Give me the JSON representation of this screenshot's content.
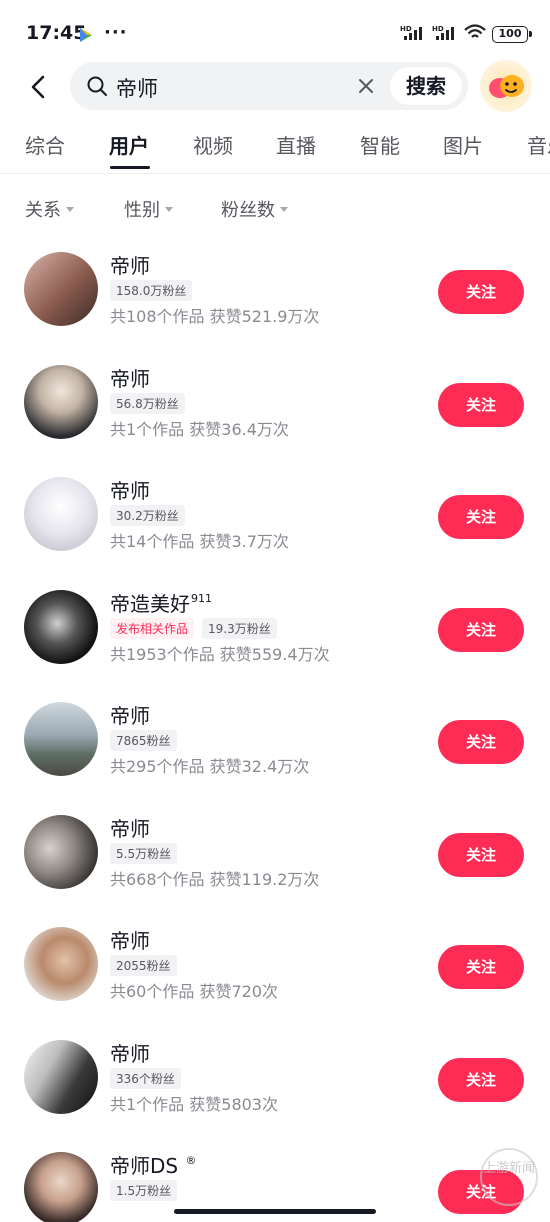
{
  "status_bar": {
    "time": "17:45",
    "dots": "···",
    "battery": "100"
  },
  "search": {
    "query": "帝师",
    "button": "搜索"
  },
  "tabs": [
    "综合",
    "用户",
    "视频",
    "直播",
    "智能",
    "图片",
    "音乐"
  ],
  "active_tab": "用户",
  "filters": [
    "关系",
    "性别",
    "粉丝数"
  ],
  "users": [
    {
      "name": "帝师",
      "badges": [
        {
          "text": "158.0万粉丝",
          "style": "gray"
        }
      ],
      "stats": "共108个作品 获赞521.9万次",
      "follow": "关注"
    },
    {
      "name": "帝师",
      "badges": [
        {
          "text": "56.8万粉丝",
          "style": "gray"
        }
      ],
      "stats": "共1个作品 获赞36.4万次",
      "follow": "关注"
    },
    {
      "name": "帝师",
      "badges": [
        {
          "text": "30.2万粉丝",
          "style": "gray"
        }
      ],
      "stats": "共14个作品 获赞3.7万次",
      "follow": "关注"
    },
    {
      "name": "帝造美好",
      "sup": "911",
      "badges": [
        {
          "text": "发布相关作品",
          "style": "pink"
        },
        {
          "text": "19.3万粉丝",
          "style": "gray"
        }
      ],
      "stats": "共1953个作品 获赞559.4万次",
      "follow": "关注"
    },
    {
      "name": "帝师",
      "badges": [
        {
          "text": "7865粉丝",
          "style": "gray"
        }
      ],
      "stats": "共295个作品 获赞32.4万次",
      "follow": "关注"
    },
    {
      "name": "帝师",
      "badges": [
        {
          "text": "5.5万粉丝",
          "style": "gray"
        }
      ],
      "stats": "共668个作品 获赞119.2万次",
      "follow": "关注"
    },
    {
      "name": "帝师",
      "badges": [
        {
          "text": "2055粉丝",
          "style": "gray"
        }
      ],
      "stats": "共60个作品 获赞720次",
      "follow": "关注"
    },
    {
      "name": "帝师",
      "badges": [
        {
          "text": "336个粉丝",
          "style": "gray"
        }
      ],
      "stats": "共1个作品 获赞5803次",
      "follow": "关注"
    },
    {
      "name": "帝师DS",
      "sup": "®",
      "badges": [
        {
          "text": "1.5万粉丝",
          "style": "gray"
        }
      ],
      "stats": "",
      "follow": "关注"
    }
  ],
  "watermark": "上游新闻",
  "colors": {
    "accent": "#fe2c55",
    "text_primary": "#161823",
    "text_secondary": "#8a8b91",
    "search_bg": "#f1f2f4"
  }
}
